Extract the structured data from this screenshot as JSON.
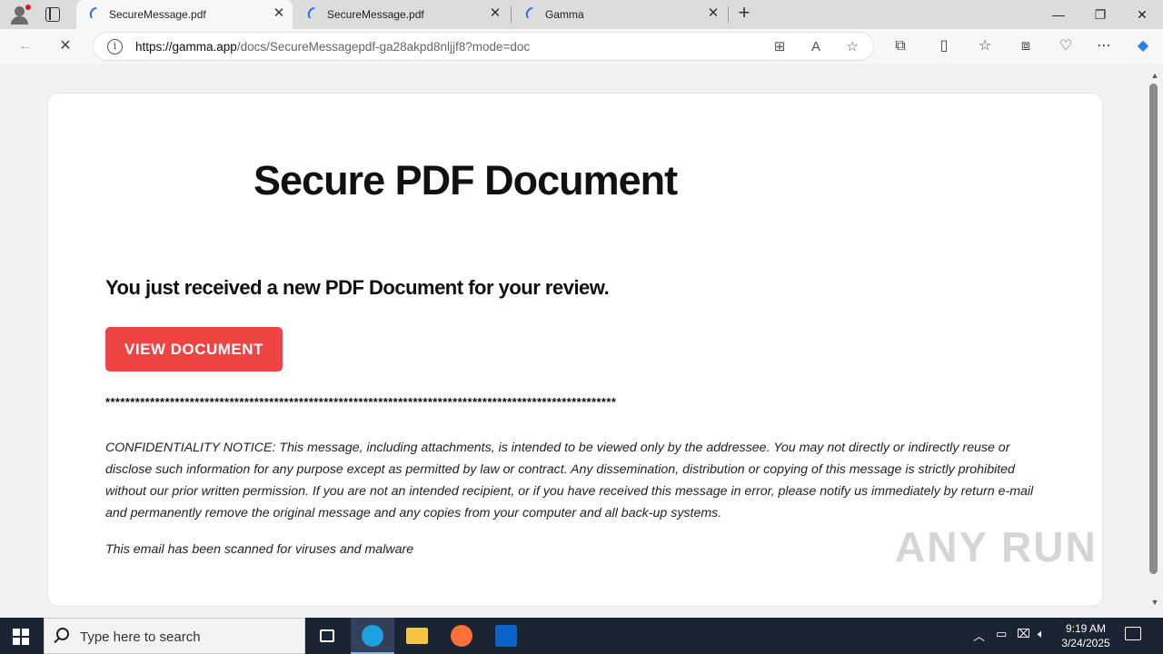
{
  "browser": {
    "tabs": [
      {
        "label": "SecureMessage.pdf",
        "active": true
      },
      {
        "label": "SecureMessage.pdf",
        "active": false
      },
      {
        "label": "Gamma",
        "active": false
      }
    ],
    "url_host": "https://gamma.app",
    "url_path": "/docs/SecureMessagepdf-ga28akpd8nljjf8?mode=doc"
  },
  "page": {
    "title": "Secure PDF Document",
    "subtitle": "You just received a new PDF Document for your review.",
    "button_label": "VIEW  DOCUMENT",
    "button_color": "#ef4444",
    "separator": "*******************************************************************************************************",
    "notice": "CONFIDENTIALITY NOTICE: This message, including attachments, is intended to be viewed only by the addressee.  You may not directly or indirectly reuse or disclose such information for any purpose except as permitted by law or contract. Any dissemination, distribution or copying of this message is strictly prohibited without our prior written permission. If you are not an intended recipient, or if you have received this message in error, please notify us immediately by return e-mail and permanently remove the original message and any copies from your computer and all back-up systems.",
    "scanned": "This email has been scanned for viruses and malware"
  },
  "watermark": "ANY RUN",
  "taskbar": {
    "search_placeholder": "Type here to search",
    "time": "9:19 AM",
    "date": "3/24/2025"
  }
}
